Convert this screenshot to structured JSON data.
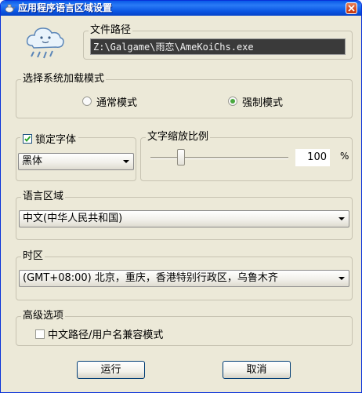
{
  "window": {
    "title": "应用程序语言区域设置",
    "title_icon": "teapot-icon",
    "close_icon": "close-icon",
    "accent_color": "#0a5ae8"
  },
  "file_path": {
    "label": "文件路径",
    "value": "Z:\\Galgame\\雨恋\\AmeKoiChs.exe"
  },
  "app_icon": "cloud-mascot-icon",
  "load_mode": {
    "label": "选择系统加载模式",
    "options": [
      {
        "label": "通常模式",
        "selected": false
      },
      {
        "label": "强制模式",
        "selected": true
      }
    ]
  },
  "font_lock": {
    "label": "锁定字体",
    "checked": true,
    "selected_font": "黑体"
  },
  "text_scale": {
    "label": "文字缩放比例",
    "value": "100",
    "unit": "%",
    "level_percent": 100
  },
  "locale": {
    "label": "语言区域",
    "selected": "中文(中华人民共和国)"
  },
  "timezone": {
    "label": "时区",
    "selected": "(GMT+08:00) 北京，重庆，香港特别行政区，乌鲁木齐"
  },
  "advanced": {
    "label": "高级选项",
    "compat_label": "中文路径/用户名兼容模式",
    "compat_checked": false
  },
  "buttons": {
    "run": "运行",
    "cancel": "取消"
  }
}
